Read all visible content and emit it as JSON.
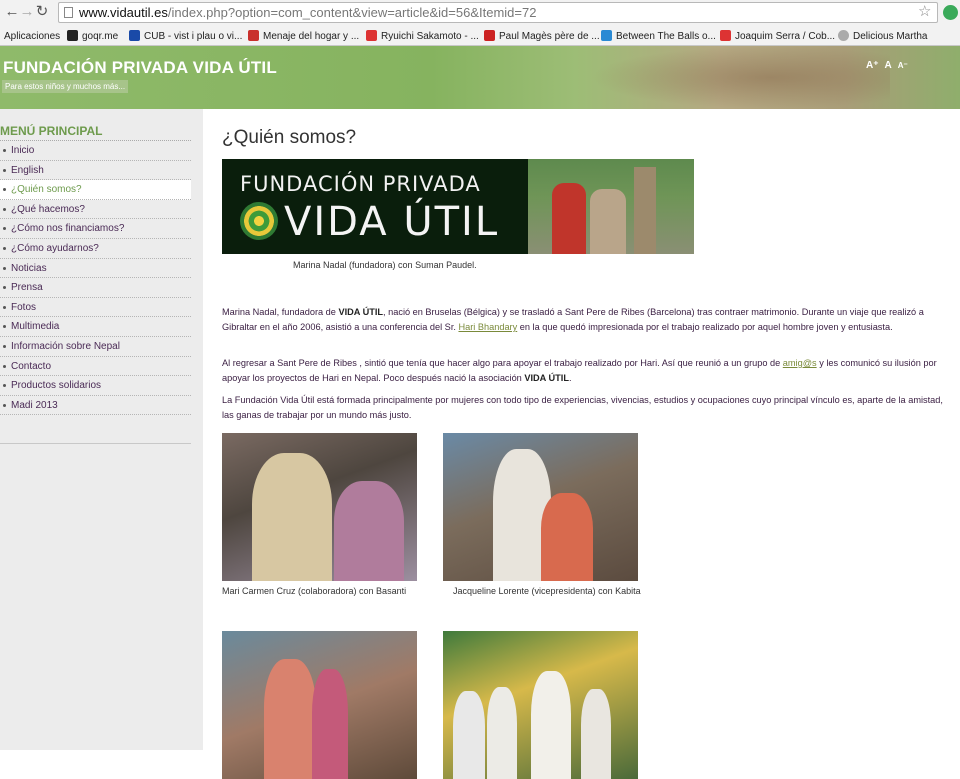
{
  "browser": {
    "url_host": "www.vidautil.es",
    "url_path": "/index.php?option=com_content&view=article&id=56&Itemid=72",
    "bookmarks": [
      {
        "label": "Aplicaciones",
        "color": "#d94"
      },
      {
        "label": "goqr.me",
        "color": "#222"
      },
      {
        "label": "CUB - vist i plau o vi...",
        "color": "#1a4aa8"
      },
      {
        "label": "Menaje del hogar y ...",
        "color": "#c9302c"
      },
      {
        "label": "Ryuichi Sakamoto - ...",
        "color": "#d32"
      },
      {
        "label": "Paul Magès père de ...",
        "color": "#c22"
      },
      {
        "label": "Between The Balls o...",
        "color": "#2a8ad4"
      },
      {
        "label": "Joaquim Serra / Cob...",
        "color": "#d32"
      },
      {
        "label": "Delicious Martha",
        "color": "#aaa"
      }
    ]
  },
  "header": {
    "title": "FUNDACIÓN PRIVADA VIDA ÚTIL",
    "subtitle": "Para estos niños y muchos más...",
    "font_controls": [
      "A⁺",
      "A",
      "A⁻"
    ]
  },
  "sidebar": {
    "title": "MENÚ PRINCIPAL",
    "items": [
      {
        "label": "Inicio"
      },
      {
        "label": "English"
      },
      {
        "label": "¿Quién somos?"
      },
      {
        "label": "¿Qué hacemos?"
      },
      {
        "label": "¿Cómo nos financiamos?"
      },
      {
        "label": "¿Cómo ayudarnos?"
      },
      {
        "label": "Noticias"
      },
      {
        "label": "Prensa"
      },
      {
        "label": "Fotos"
      },
      {
        "label": "Multimedia"
      },
      {
        "label": "Información sobre Nepal"
      },
      {
        "label": "Contacto"
      },
      {
        "label": "Productos solidarios"
      },
      {
        "label": "Madi 2013"
      }
    ],
    "active_index": 2
  },
  "main": {
    "title": "¿Quién somos?",
    "hero": {
      "line1": "FUNDACIÓN PRIVADA",
      "line2": "VIDA ÚTIL",
      "caption": "Marina Nadal (fundadora) con Suman Paudel."
    },
    "paragraphs": {
      "p1_a": "Marina Nadal, fundadora de ",
      "p1_b": "VIDA ÚTIL",
      "p1_c": ", nació en Bruselas (Bélgica) y se trasladó a Sant Pere de Ribes (Barcelona) tras contraer matrimonio. Durante un viaje que realizó a Gibraltar en el año 2006, asistió a una conferencia del Sr. ",
      "p1_link": "Hari Bhandary",
      "p1_d": " en la que quedó impresionada por el trabajo realizado por aquel hombre joven y entusiasta.",
      "p2_a": "Al regresar a Sant Pere de Ribes , sintió que tenía que hacer algo para apoyar el trabajo realizado por Hari. Así que reunió a un grupo de ",
      "p2_link": "amig@s",
      "p2_b": " y les comunicó su ilusión por apoyar los proyectos de Hari en Nepal. Poco después nació la asociación ",
      "p2_c": "VIDA ÚTIL",
      "p2_d": ".",
      "p3": "La Fundación Vida Útil está formada principalmente por mujeres con todo tipo de experiencias, vivencias, estudios y ocupaciones cuyo principal vínculo es, aparte de la amistad, las ganas de trabajar por un mundo más justo."
    },
    "photos": [
      {
        "caption": "Mari Carmen Cruz (colaboradora) con Basanti"
      },
      {
        "caption": "Jacqueline Lorente (vicepresidenta) con Kabita"
      },
      {
        "caption": ""
      },
      {
        "caption": ""
      }
    ]
  }
}
